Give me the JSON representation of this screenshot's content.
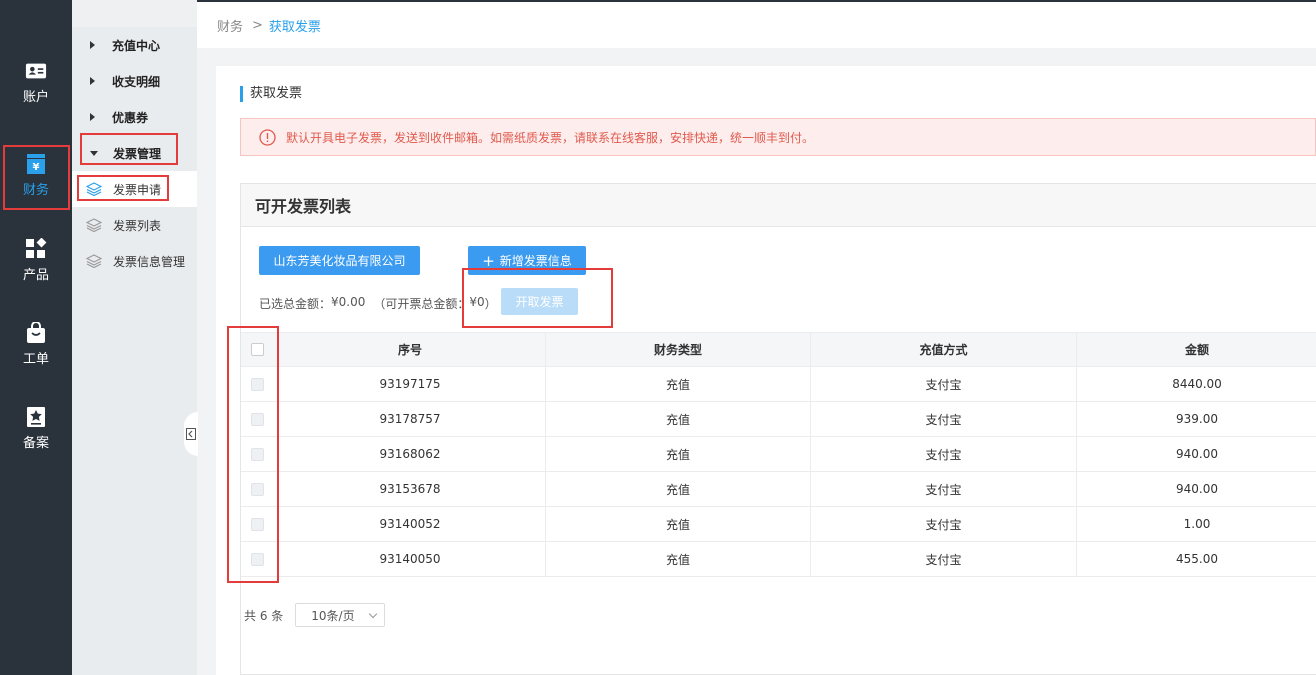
{
  "rail": {
    "items": [
      {
        "label": "账户",
        "icon": "id-card-icon"
      },
      {
        "label": "财务",
        "icon": "finance-icon"
      },
      {
        "label": "产品",
        "icon": "apps-icon"
      },
      {
        "label": "工单",
        "icon": "bag-icon"
      },
      {
        "label": "备案",
        "icon": "star-badge-icon"
      }
    ],
    "active_color": "#2aa0ea"
  },
  "subnav": {
    "groups": [
      {
        "label": "充值中心"
      },
      {
        "label": "收支明细"
      },
      {
        "label": "优惠券"
      },
      {
        "label": "发票管理"
      }
    ],
    "items": [
      {
        "label": "发票申请"
      },
      {
        "label": "发票列表"
      },
      {
        "label": "发票信息管理"
      }
    ]
  },
  "breadcrumb": {
    "root": "财务",
    "sep": ">",
    "current": "获取发票"
  },
  "section_title": "获取发票",
  "notice": "默认开具电子发票，发送到收件邮箱。如需纸质发票，请联系在线客服，安排快递，统一顺丰到付。",
  "panel": {
    "title": "可开发票列表",
    "company_button": "山东芳美化妆品有限公司",
    "add_button": "新增发票信息",
    "selected_label": "已选总金额：",
    "selected_amount": "¥0.00",
    "available_label": "（可开票总金额：",
    "available_amount": "¥0",
    "available_close": "）",
    "issue_button": "开取发票"
  },
  "table": {
    "columns": [
      "序号",
      "财务类型",
      "充值方式",
      "金额"
    ],
    "rows": [
      [
        "93197175",
        "充值",
        "支付宝",
        "8440.00"
      ],
      [
        "93178757",
        "充值",
        "支付宝",
        "939.00"
      ],
      [
        "93168062",
        "充值",
        "支付宝",
        "940.00"
      ],
      [
        "93153678",
        "充值",
        "支付宝",
        "940.00"
      ],
      [
        "93140052",
        "充值",
        "支付宝",
        "1.00"
      ],
      [
        "93140050",
        "充值",
        "支付宝",
        "455.00"
      ]
    ]
  },
  "pager": {
    "total": "共 6 条",
    "page_size": "10条/页"
  },
  "colors": {
    "primary": "#3b9bf0",
    "annotation": "#e43b3b",
    "notice_text": "#e05a4e"
  }
}
